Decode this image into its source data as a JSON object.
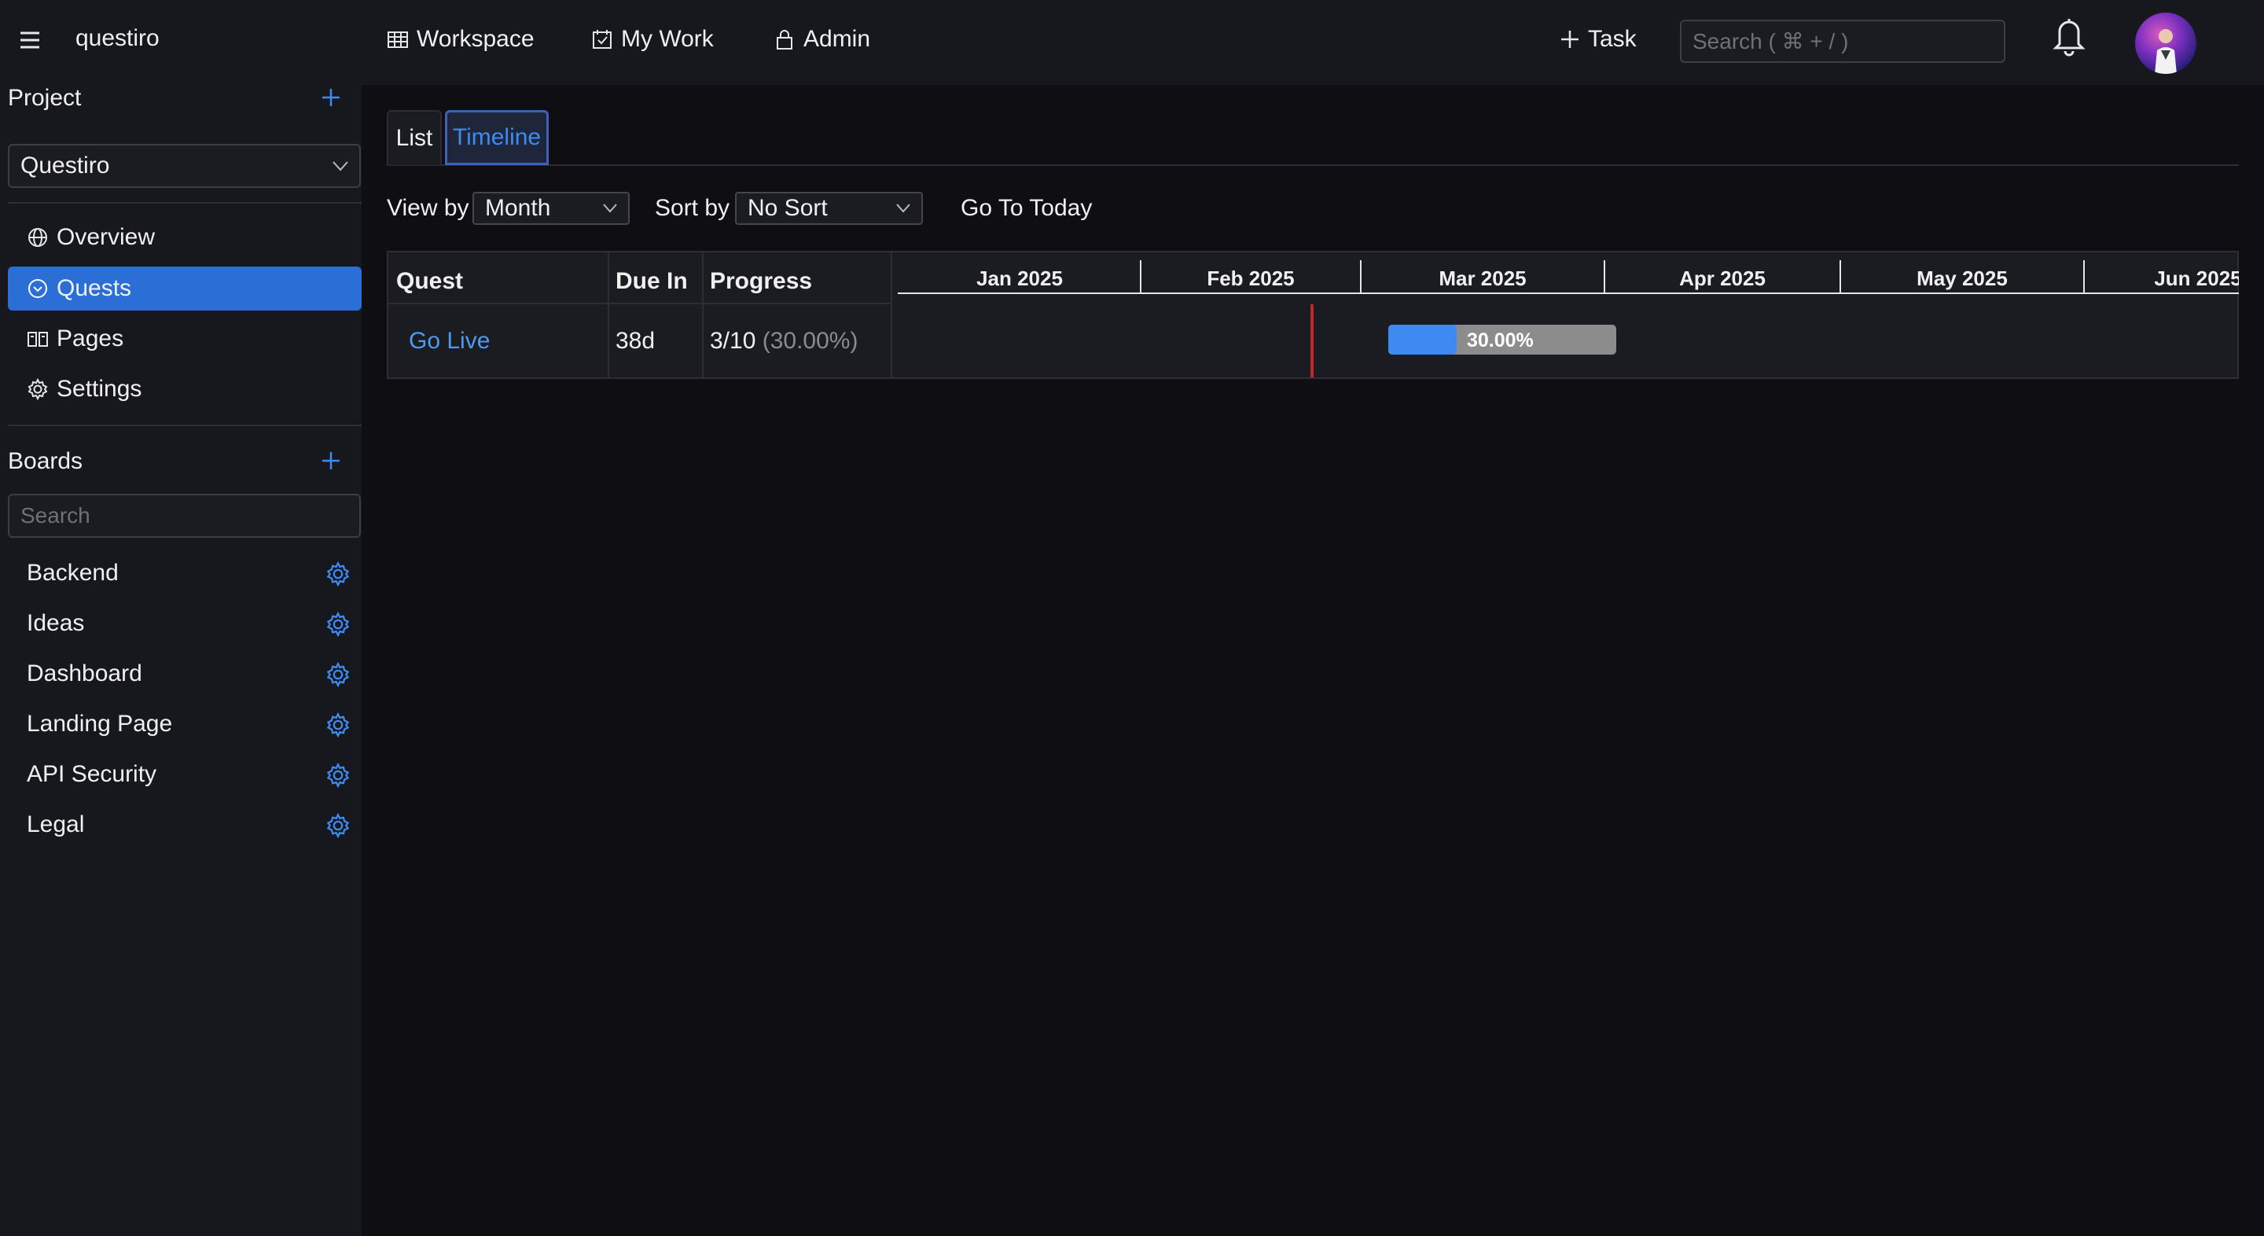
{
  "app": {
    "name": "questiro"
  },
  "topnav": {
    "items": [
      {
        "label": "Workspace",
        "icon": "grid-icon"
      },
      {
        "label": "My Work",
        "icon": "calendar-check-icon"
      },
      {
        "label": "Admin",
        "icon": "lock-icon"
      }
    ],
    "task_label": "Task",
    "search_placeholder": "Search ( ⌘ + / )"
  },
  "sidebar": {
    "project_title": "Project",
    "project_selected": "Questiro",
    "nav": [
      {
        "label": "Overview",
        "icon": "globe-icon",
        "active": false
      },
      {
        "label": "Quests",
        "icon": "circle-chevron-icon",
        "active": true
      },
      {
        "label": "Pages",
        "icon": "book-icon",
        "active": false
      },
      {
        "label": "Settings",
        "icon": "gear-icon",
        "active": false
      }
    ],
    "boards_title": "Boards",
    "boards_search_placeholder": "Search",
    "boards": [
      "Backend",
      "Ideas",
      "Dashboard",
      "Landing Page",
      "API Security",
      "Legal"
    ]
  },
  "main": {
    "tabs": [
      {
        "label": "List",
        "active": false
      },
      {
        "label": "Timeline",
        "active": true
      }
    ],
    "view_by_label": "View by",
    "view_by_value": "Month",
    "sort_by_label": "Sort by",
    "sort_by_value": "No Sort",
    "go_today_label": "Go To Today",
    "table": {
      "headers": {
        "quest": "Quest",
        "due": "Due In",
        "progress": "Progress"
      },
      "months": [
        "Jan 2025",
        "Feb 2025",
        "Mar 2025",
        "Apr 2025",
        "May 2025",
        "Jun 2025"
      ],
      "rows": [
        {
          "quest": "Go Live",
          "due": "38d",
          "progress_count": "3/10",
          "progress_pct_text": "(30.00%)",
          "bar_label": "30.00%",
          "progress_fraction": 0.3
        }
      ]
    }
  },
  "colors": {
    "accent": "#2b6fd6",
    "link": "#4b9bf0",
    "progress_fill": "#3d8bf0",
    "progress_track": "#8c8c8c",
    "today_line": "#c0282d",
    "background": "#0f0f13",
    "panel": "#17181d"
  }
}
